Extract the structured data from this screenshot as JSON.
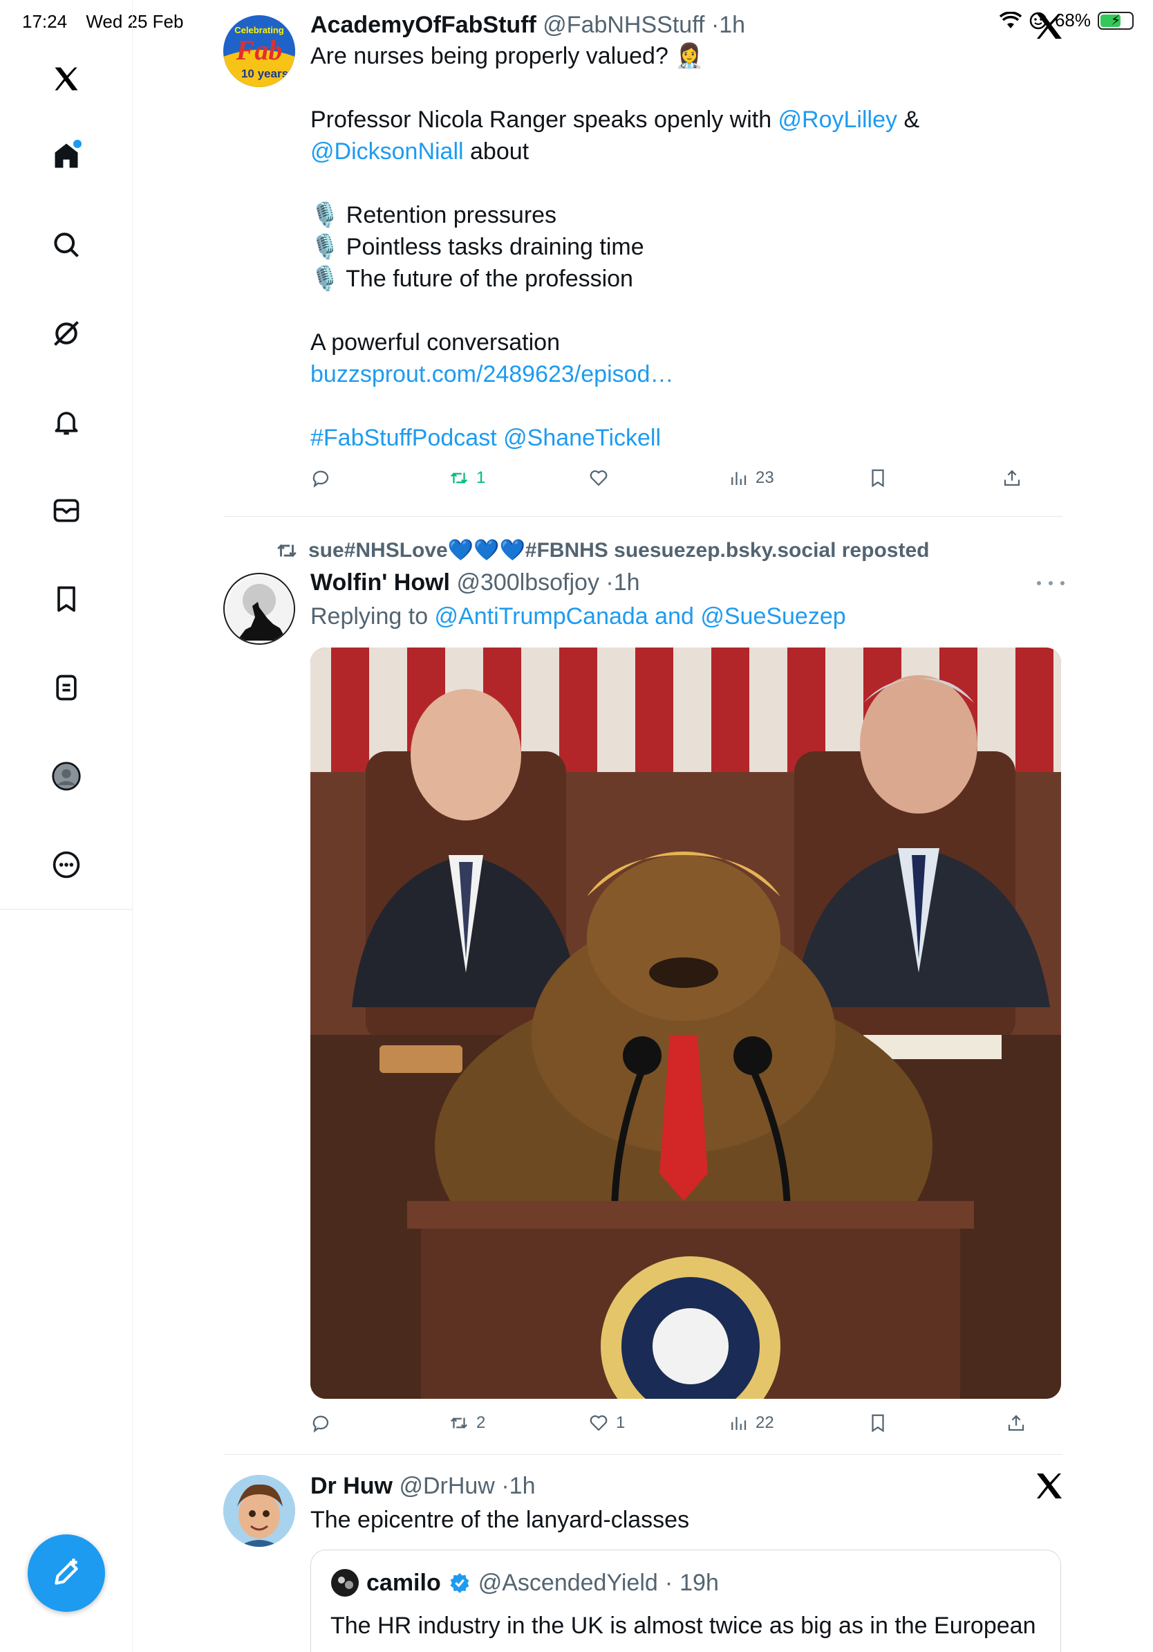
{
  "status": {
    "time": "17:24",
    "date": "Wed 25 Feb",
    "battery": "68%"
  },
  "colors": {
    "accent": "#1d9bf0",
    "retweet": "#00ba7c",
    "text": "#0f1419",
    "muted": "#536471"
  },
  "sidebar": {
    "items": [
      {
        "icon": "x-logo-icon"
      },
      {
        "icon": "home-icon"
      },
      {
        "icon": "search-icon"
      },
      {
        "icon": "grok-icon"
      },
      {
        "icon": "bell-icon"
      },
      {
        "icon": "mail-icon"
      },
      {
        "icon": "bookmark-icon"
      },
      {
        "icon": "list-icon"
      },
      {
        "icon": "profile-icon"
      },
      {
        "icon": "more-icon"
      }
    ]
  },
  "tweet1": {
    "name": "AcademyOfFabStuff",
    "handle": "@FabNHSStuff",
    "time": "1h",
    "avatar_text_top": "Celebrating",
    "avatar_text_mid": "Fab",
    "avatar_text_bottom": "10 years",
    "line1": "Are nurses being properly valued? 👩‍⚕️",
    "line2_pre": "Professor Nicola Ranger speaks openly with ",
    "mention1": "@RoyLilley",
    "amp": " &",
    "mention2": "@DicksonNiall",
    "line3_post": " about",
    "bullet1": "🎙️ Retention pressures",
    "bullet2": "🎙️ Pointless tasks draining time",
    "bullet3": "🎙️ The future of the profession",
    "line4": "A powerful conversation",
    "url": "buzzsprout.com/2489623/episod…",
    "hashtag": "#FabStuffPodcast",
    "mention3": "@ShaneTickell",
    "retweets": "1",
    "views": "23"
  },
  "tweet2": {
    "repost_label": "sue#NHSLove💙💙💙#FBNHS suesuezep.bsky.social reposted",
    "name": "Wolfin' Howl",
    "handle": "@300lbsofjoy",
    "time": "1h",
    "replying_to": "Replying to ",
    "reply_mentions": "@AntiTrumpCanada and @SueSuezep",
    "retweets": "2",
    "likes": "1",
    "views": "22"
  },
  "tweet3": {
    "name": "Dr Huw",
    "handle": "@DrHuw",
    "time": "1h",
    "text": "The epicentre of the lanyard-classes",
    "quote_name": "camilo",
    "quote_handle": "@AscendedYield",
    "quote_time": "19h",
    "quote_text": "The HR industry in the UK is almost twice as big as in the European"
  }
}
